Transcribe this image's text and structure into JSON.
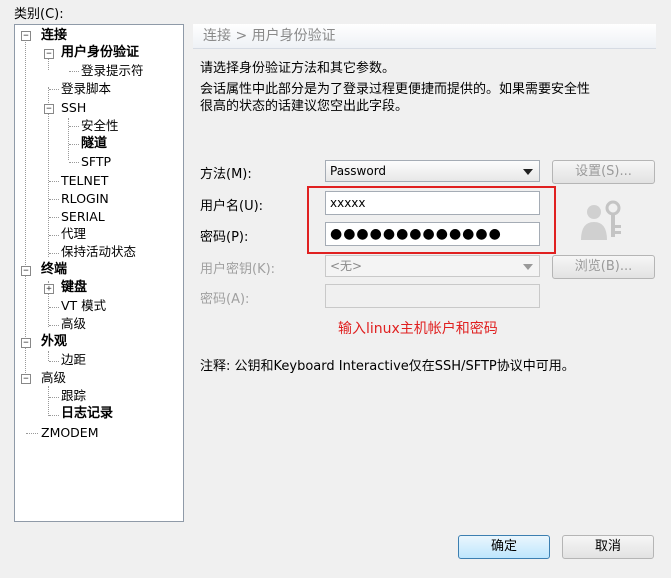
{
  "category_label": "类别(C):",
  "tree": {
    "connection": "连接",
    "auth": "用户身份验证",
    "login_prompts": "登录提示符",
    "login_script": "登录脚本",
    "ssh": "SSH",
    "security": "安全性",
    "tunnel": "隧道",
    "sftp": "SFTP",
    "telnet": "TELNET",
    "rlogin": "RLOGIN",
    "serial": "SERIAL",
    "proxy": "代理",
    "keepalive": "保持活动状态",
    "terminal": "终端",
    "keyboard": "键盘",
    "vt_mode": "VT 模式",
    "advanced1": "高级",
    "appearance": "外观",
    "margin": "边距",
    "advanced2": "高级",
    "trace": "跟踪",
    "logging": "日志记录",
    "zmodem": "ZMODEM"
  },
  "panel": {
    "breadcrumb": "连接 > 用户身份验证",
    "desc1": "请选择身份验证方法和其它参数。",
    "desc2": "会话属性中此部分是为了登录过程更便捷而提供的。如果需要安全性",
    "desc3": "很高的状态的话建议您空出此字段。",
    "method_label": "方法(M):",
    "method_value": "Password",
    "settings_button": "设置(S)...",
    "username_label": "用户名(U):",
    "username_value": "xxxxx",
    "password_label": "密码(P):",
    "password_value": "●●●●●●●●●●●●●",
    "user_key_label": "用户密钥(K):",
    "user_key_value": "<无>",
    "browse_button": "浏览(B)...",
    "passphrase_label": "密码(A):",
    "passphrase_value": "",
    "annotation": "输入linux主机帐户和密码",
    "note": "注释: 公钥和Keyboard Interactive仅在SSH/SFTP协议中可用。"
  },
  "buttons": {
    "ok": "确定",
    "cancel": "取消"
  },
  "colors": {
    "annotation": "#e02020",
    "ok_border": "#3c7fb1"
  }
}
